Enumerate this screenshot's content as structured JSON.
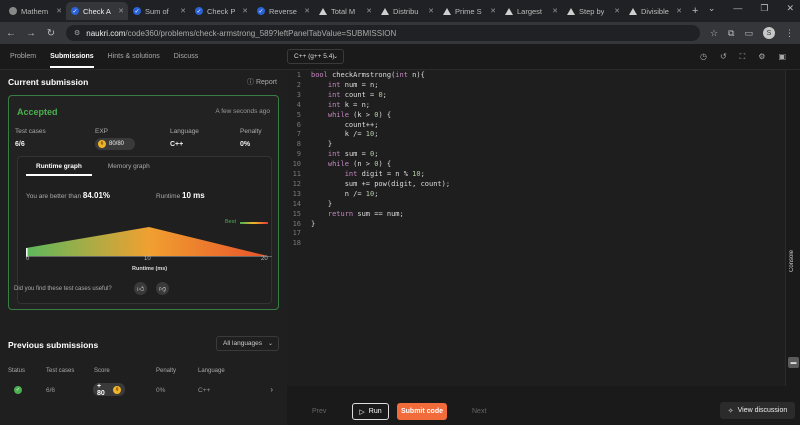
{
  "browser": {
    "tabs": [
      {
        "label": "Mathem",
        "icon": "globe-icon",
        "active": false
      },
      {
        "label": "Check A",
        "icon": "naukri-icon",
        "active": true
      },
      {
        "label": "Sum of",
        "icon": "naukri-icon",
        "active": false
      },
      {
        "label": "Check P",
        "icon": "naukri-icon",
        "active": false
      },
      {
        "label": "Reverse",
        "icon": "naukri-icon",
        "active": false
      },
      {
        "label": "Total M",
        "icon": "triangle-icon",
        "active": false
      },
      {
        "label": "Distribu",
        "icon": "triangle-icon",
        "active": false
      },
      {
        "label": "Prime S",
        "icon": "triangle-icon",
        "active": false
      },
      {
        "label": "Largest",
        "icon": "triangle-icon",
        "active": false
      },
      {
        "label": "Step by",
        "icon": "triangle-icon",
        "active": false
      },
      {
        "label": "Divisible",
        "icon": "triangle-icon",
        "active": false
      }
    ],
    "new_tab": "+",
    "url_host": "naukri.com",
    "url_path": "/code360/problems/check-armstrong_589?leftPanelTabValue=SUBMISSION",
    "profile_initial": "S"
  },
  "left_tabs": [
    "Problem",
    "Submissions",
    "Hints & solutions",
    "Discuss"
  ],
  "current": {
    "heading": "Current submission",
    "report": "Report",
    "status": "Accepted",
    "time_ago": "A few seconds ago",
    "test_cases_label": "Test cases",
    "test_cases_value": "6/6",
    "exp_label": "EXP",
    "exp_value": "80/80",
    "language_label": "Language",
    "language_value": "C++",
    "penalty_label": "Penalty",
    "penalty_value": "0%"
  },
  "graph": {
    "tab_runtime": "Runtime graph",
    "tab_memory": "Memory graph",
    "better_prefix": "You are better than",
    "better_value": "84.01%",
    "runtime_label": "Runtime",
    "runtime_value": "10 ms",
    "best_label": "Best",
    "x_ticks": [
      "0",
      "10",
      "20"
    ],
    "x_label": "Runtime (ms)",
    "useful_question": "Did you find these test cases useful?"
  },
  "chart_data": {
    "type": "area",
    "x": [
      0,
      10,
      20
    ],
    "y": [
      0.3,
      1.0,
      0.0
    ],
    "xlabel": "Runtime (ms)",
    "xlim": [
      0,
      20
    ],
    "highlight_x": 10
  },
  "previous": {
    "heading": "Previous submissions",
    "filter": "All languages",
    "columns": [
      "Status",
      "Test cases",
      "Score",
      "Penalty",
      "Language"
    ],
    "row": {
      "test_cases": "6/6",
      "score": "+ 80",
      "penalty": "0%",
      "language": "C++"
    }
  },
  "editor": {
    "language": "C++ (g++ 5.4)",
    "lines": [
      "bool checkArmstrong(int n){",
      "    int num = n;",
      "    int count = 0;",
      "    int k = n;",
      "    while (k > 0) {",
      "        count++;",
      "        k /= 10;",
      "    }",
      "    int sum = 0;",
      "    while (n > 0) {",
      "        int digit = n % 10;",
      "        sum += pow(digit, count);",
      "        n /= 10;",
      "    }",
      "    return sum == num;",
      "}",
      "",
      ""
    ],
    "line_numbers": [
      "1",
      "2",
      "3",
      "4",
      "5",
      "6",
      "7",
      "8",
      "9",
      "10",
      "11",
      "12",
      "13",
      "14",
      "15",
      "16",
      "17",
      "18"
    ],
    "console_label": "Console"
  },
  "bottom": {
    "prev": "Prev",
    "run": "Run",
    "submit": "Submit code",
    "next": "Next",
    "view_discussion": "View discussion"
  },
  "colors": {
    "accent": "#4caf50",
    "submit": "#f26b3a",
    "keyword": "#c586c0",
    "number": "#b5cea8"
  }
}
